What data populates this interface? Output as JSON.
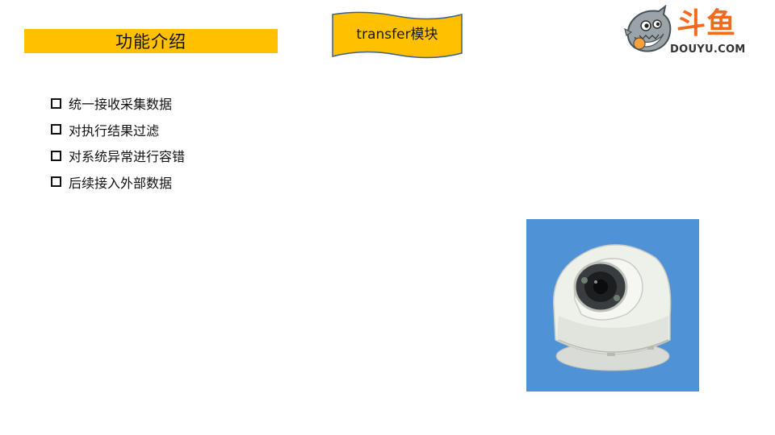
{
  "slide": {
    "title": "功能介绍",
    "module_tag": "transfer模块",
    "logo": {
      "cn": "斗鱼",
      "en": "DOUYU.COM",
      "accent_color": "#F26B1D"
    },
    "title_bar_color": "#FFC000",
    "bullet_icon": "checkbox-icon",
    "bullets": [
      {
        "label": "统一接收采集数据"
      },
      {
        "label": "对执行结果过滤"
      },
      {
        "label": "对系统异常进行容错"
      },
      {
        "label": "后续接入外部数据"
      }
    ],
    "photo": {
      "subject": "dome-camera-image",
      "background_color": "#4F92D6"
    }
  }
}
